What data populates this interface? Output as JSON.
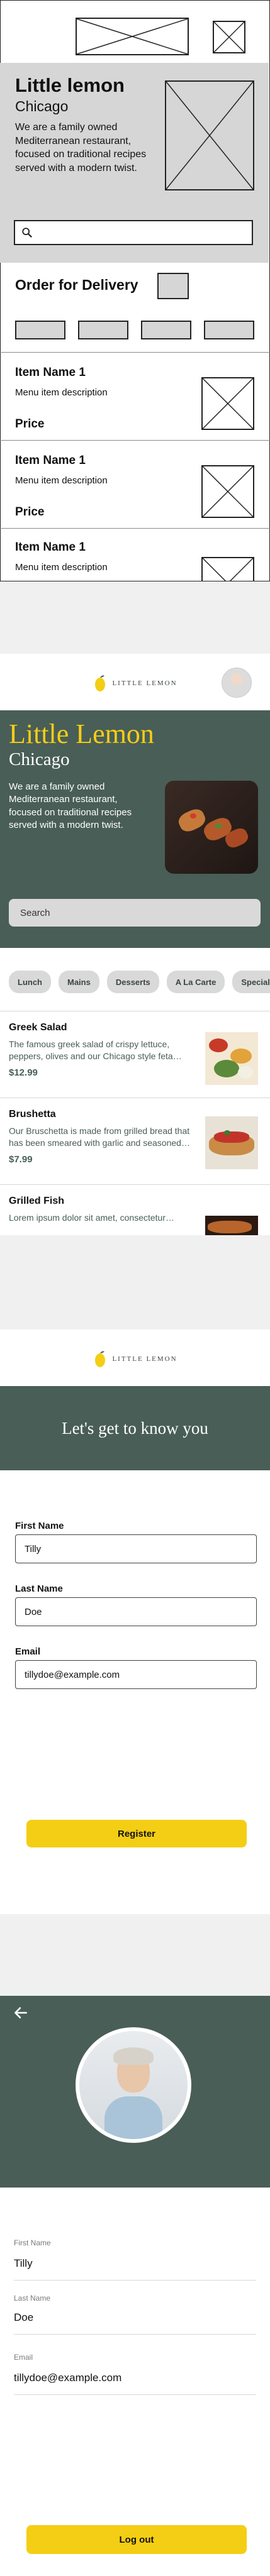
{
  "wireframe": {
    "title": "Little lemon",
    "subtitle": "Chicago",
    "description": "We are a family owned Mediterranean restaurant, focused on traditional recipes served with a modern twist.",
    "search_icon": "search-icon",
    "order_label": "Order for Delivery",
    "items": [
      {
        "name": "Item Name 1",
        "description": "Menu item description",
        "price": "Price"
      },
      {
        "name": "Item Name 1",
        "description": "Menu item description",
        "price": "Price"
      },
      {
        "name": "Item Name 1",
        "description": "Menu item description"
      }
    ]
  },
  "home": {
    "logo_text": "LITTLE LEMON",
    "hero_title": "Little Lemon",
    "hero_subtitle": "Chicago",
    "hero_description": "We are a family owned Mediterranean restaurant, focused on traditional recipes served with a modern twist.",
    "search_placeholder": "Search",
    "categories": [
      "Lunch",
      "Mains",
      "Desserts",
      "A La Carte",
      "Specials"
    ],
    "dishes": [
      {
        "name": "Greek Salad",
        "description": "The famous greek salad of crispy lettuce, peppers, olives and our Chicago style feta cheese",
        "price": "$12.99"
      },
      {
        "name": "Brushetta",
        "description": "Our Bruschetta is made from grilled bread that has been smeared with garlic and seasoned with salt and olive oil",
        "price": "$7.99"
      },
      {
        "name": "Grilled Fish",
        "description": "Lorem ipsum dolor sit amet, consectetur adipiscing elit"
      }
    ],
    "colors": {
      "primary": "#495e57",
      "accent": "#f4ce14"
    }
  },
  "onboarding": {
    "logo_text": "LITTLE LEMON",
    "heading": "Let's get to know you",
    "first_name_label": "First Name",
    "first_name_value": "Tilly",
    "last_name_label": "Last Name",
    "last_name_value": "Doe",
    "email_label": "Email",
    "email_value": "tillydoe@example.com",
    "register_label": "Register"
  },
  "profile": {
    "back_icon": "arrow-left-icon",
    "first_name_label": "First Name",
    "first_name_value": "Tilly",
    "last_name_label": "Last Name",
    "last_name_value": "Doe",
    "email_label": "Email",
    "email_value": "tillydoe@example.com",
    "logout_label": "Log out"
  }
}
